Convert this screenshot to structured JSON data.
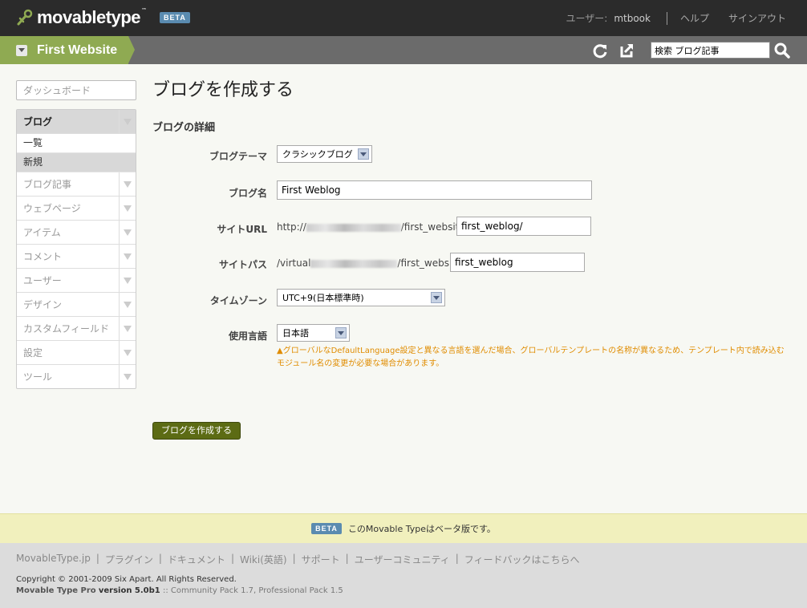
{
  "header": {
    "logo": "movabletype",
    "tm": "™",
    "beta": "BETA",
    "user_label": "ユーザー:",
    "username": "mtbook",
    "help": "ヘルプ",
    "signout": "サインアウト"
  },
  "sitebar": {
    "site_name": "First Website",
    "search_value": "検索 ブログ記事"
  },
  "sidebar": {
    "dashboard": "ダッシュボード",
    "blog": "ブログ",
    "blog_subitems": [
      "一覧",
      "新規"
    ],
    "items": [
      "ブログ記事",
      "ウェブページ",
      "アイテム",
      "コメント",
      "ユーザー",
      "デザイン",
      "カスタムフィールド",
      "設定",
      "ツール"
    ]
  },
  "main": {
    "title": "ブログを作成する",
    "section": "ブログの詳細",
    "fields": {
      "theme_label": "ブログテーマ",
      "theme_value": "クラシックブログ",
      "name_label": "ブログ名",
      "name_value": "First Weblog",
      "url_label": "サイトURL",
      "url_prefix_start": "http://",
      "url_prefix_end": "/first_website/",
      "url_value": "first_weblog/",
      "path_label": "サイトパス",
      "path_prefix_start": "/virtual",
      "path_prefix_end": "/first_website/",
      "path_value": "first_weblog",
      "tz_label": "タイムゾーン",
      "tz_value": "UTC+9(日本標準時)",
      "lang_label": "使用言語",
      "lang_value": "日本語"
    },
    "warning": "▲グローバルなDefaultLanguage設定と異なる言語を選んだ場合、グローバルテンプレートの名称が異なるため、テンプレート内で読み込むモジュール名の変更が必要な場合があります。",
    "create_button": "ブログを作成する"
  },
  "footer": {
    "beta": "BETA",
    "banner_msg": "このMovable Typeはベータ版です。",
    "links": [
      "MovableType.jp",
      "プラグイン",
      "ドキュメント",
      "Wiki(英語)",
      "サポート",
      "ユーザーコミュニティ",
      "フィードバックはこちらへ"
    ],
    "copyright": "Copyright © 2001-2009 Six Apart. All Rights Reserved.",
    "version_product": "Movable Type Pro",
    "version_label": "version 5.0b1",
    "version_extra": ":: Community Pack 1.7, Professional Pack 1.5"
  }
}
